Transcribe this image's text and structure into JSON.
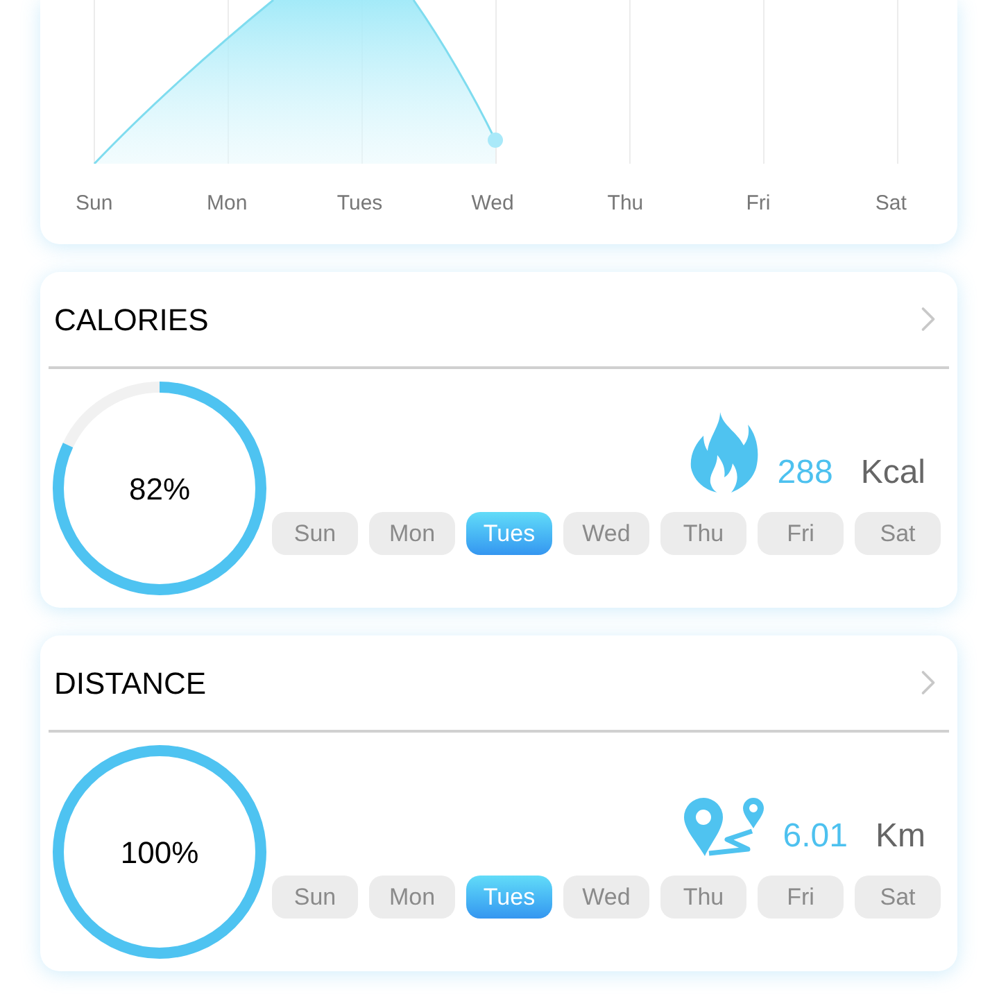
{
  "week_chart": {
    "day_labels": [
      "Sun",
      "Mon",
      "Tues",
      "Wed",
      "Thu",
      "Fri",
      "Sat"
    ]
  },
  "cards": [
    {
      "kind": "calories",
      "title": "CALORIES",
      "ring": {
        "level": 0.82,
        "label": "82%"
      },
      "value": "288",
      "unit": "Kcal",
      "days": [
        {
          "label": "Sun",
          "selected": false
        },
        {
          "label": "Mon",
          "selected": false
        },
        {
          "label": "Tues",
          "selected": true
        },
        {
          "label": "Wed",
          "selected": false
        },
        {
          "label": "Thu",
          "selected": false
        },
        {
          "label": "Fri",
          "selected": false
        },
        {
          "label": "Sat",
          "selected": false
        }
      ]
    },
    {
      "kind": "distance",
      "title": "DISTANCE",
      "ring": {
        "level": 1,
        "label": "100%"
      },
      "value": "6.01",
      "unit": "Km",
      "days": [
        {
          "label": "Sun",
          "selected": false
        },
        {
          "label": "Mon",
          "selected": false
        },
        {
          "label": "Tues",
          "selected": true
        },
        {
          "label": "Wed",
          "selected": false
        },
        {
          "label": "Thu",
          "selected": false
        },
        {
          "label": "Fri",
          "selected": false
        },
        {
          "label": "Sat",
          "selected": false
        }
      ]
    }
  ]
}
